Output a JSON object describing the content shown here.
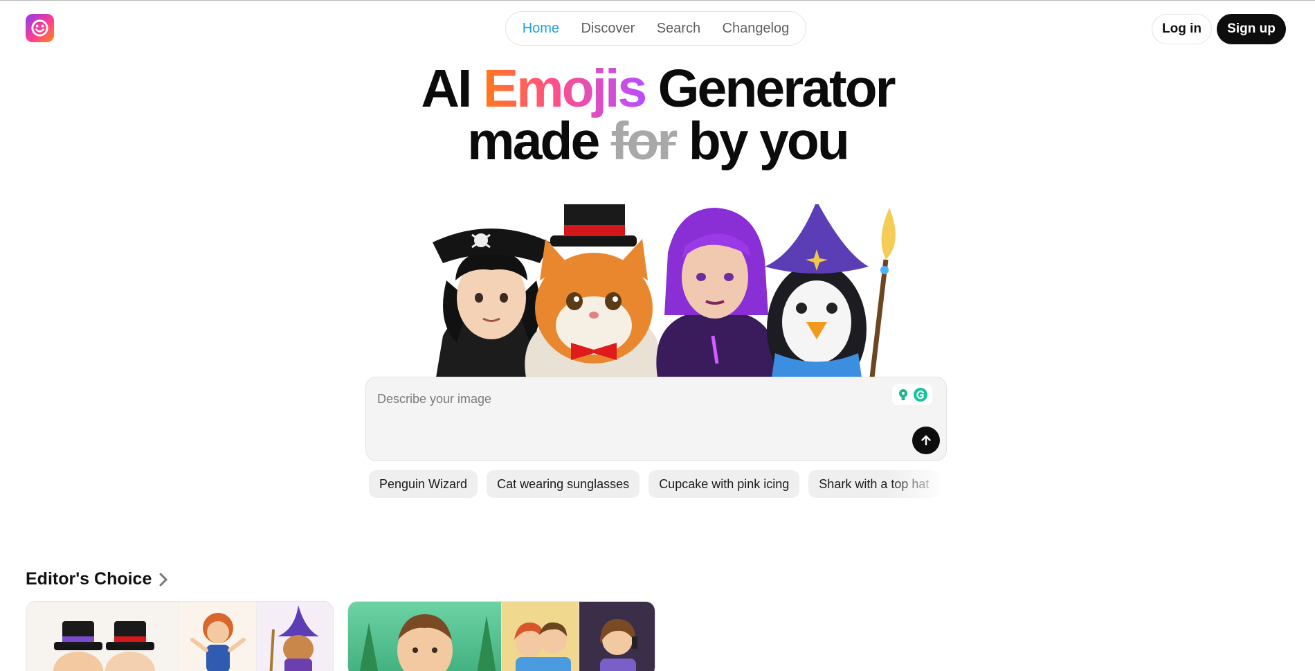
{
  "header": {
    "logo_icon": "smiley-face-icon",
    "nav": [
      {
        "label": "Home",
        "active": true
      },
      {
        "label": "Discover",
        "active": false
      },
      {
        "label": "Search",
        "active": false
      },
      {
        "label": "Changelog",
        "active": false
      }
    ],
    "login_label": "Log in",
    "signup_label": "Sign up"
  },
  "hero": {
    "line1_a": "AI ",
    "line1_highlight": "Emojis",
    "line1_b": " Generator",
    "line2_a": "made ",
    "line2_strike": "for",
    "line2_b": " by you",
    "characters": [
      "pirate-boy",
      "cat-in-top-hat",
      "purple-hair-woman",
      "penguin-wizard"
    ]
  },
  "prompt": {
    "placeholder": "Describe your image",
    "value": "",
    "send_icon": "arrow-up-icon"
  },
  "suggestions": [
    "Penguin Wizard",
    "Cat wearing sunglasses",
    "Cupcake with pink icing",
    "Shark with a top hat"
  ],
  "editors_choice": {
    "title": "Editor's Choice",
    "chevron_icon": "chevron-right-icon"
  },
  "colors": {
    "accent": "#1aa0e0",
    "dark": "#0d0d0d",
    "gradient_start": "#ff7a1a",
    "gradient_end": "#b84dff"
  }
}
